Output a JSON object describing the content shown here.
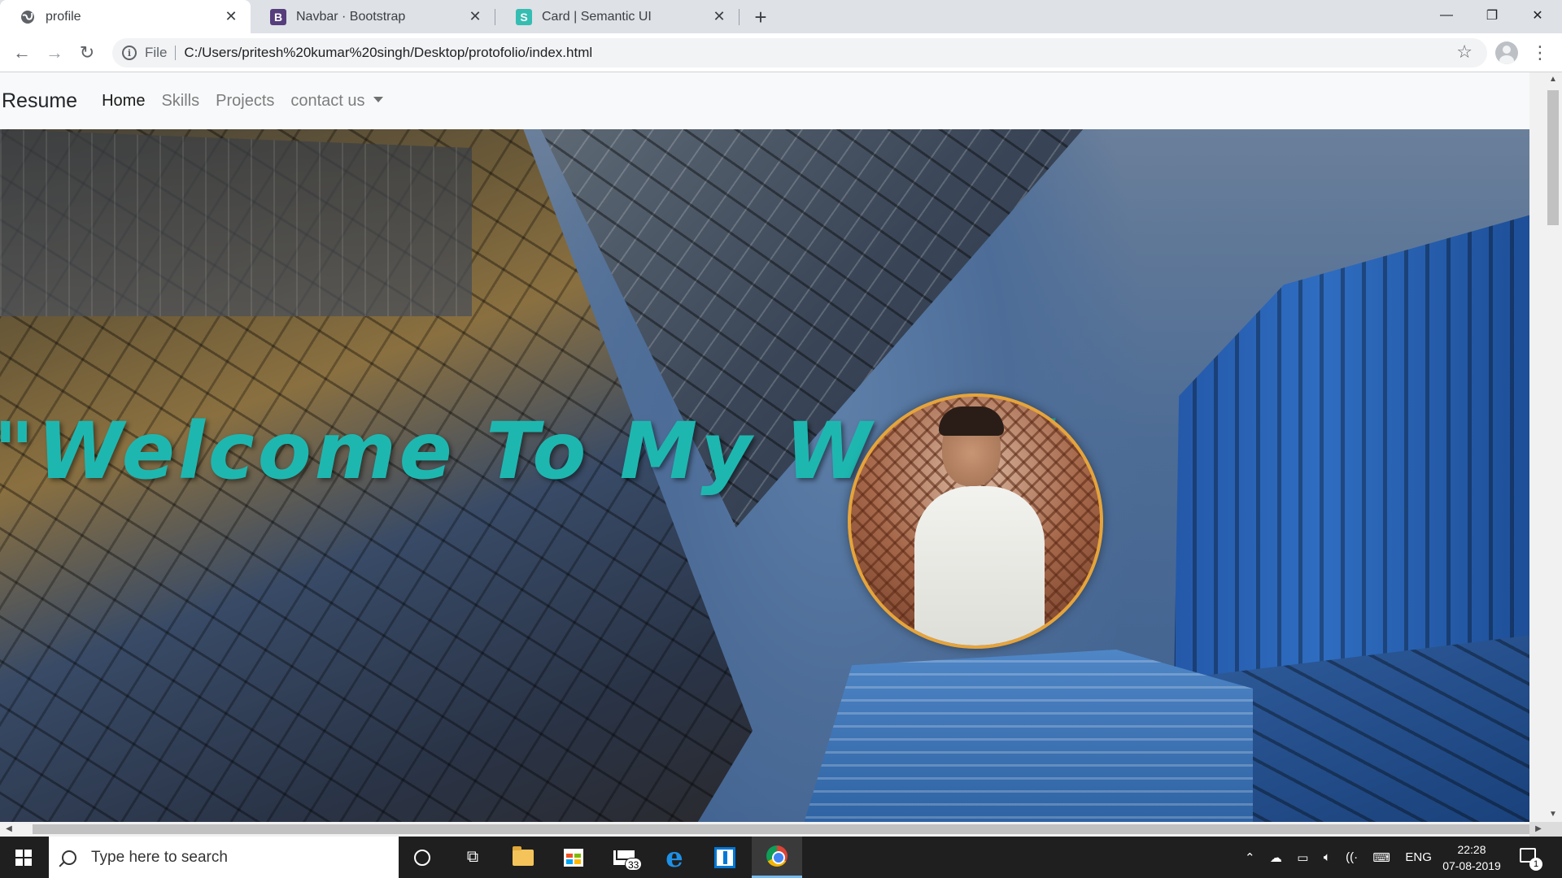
{
  "browser": {
    "tabs": [
      {
        "title": "profile",
        "icon": "globe-icon"
      },
      {
        "title": "Navbar · Bootstrap",
        "icon": "bootstrap-icon",
        "icon_letter": "B",
        "icon_color": "#563d7c"
      },
      {
        "title": "Card | Semantic UI",
        "icon": "semantic-ui-icon",
        "icon_letter": "S",
        "icon_color": "#35bdb2"
      }
    ],
    "address": {
      "scheme_label": "File",
      "url": "C:/Users/pritesh%20kumar%20singh/Desktop/protofolio/index.html"
    }
  },
  "site": {
    "brand": "Resume",
    "nav": [
      {
        "label": "Home",
        "active": true
      },
      {
        "label": "Skills",
        "active": false
      },
      {
        "label": "Projects",
        "active": false
      },
      {
        "label": "contact us",
        "active": false,
        "dropdown": true
      }
    ],
    "hero": {
      "headline": "\"Welcome To My World",
      "headline_color": "#1eb7b0",
      "avatar_border_color": "#e6a43a"
    }
  },
  "taskbar": {
    "search_placeholder": "Type here to search",
    "mail_badge": "33",
    "language": "ENG",
    "time": "22:28",
    "date": "07-08-2019",
    "notifications": "1"
  }
}
